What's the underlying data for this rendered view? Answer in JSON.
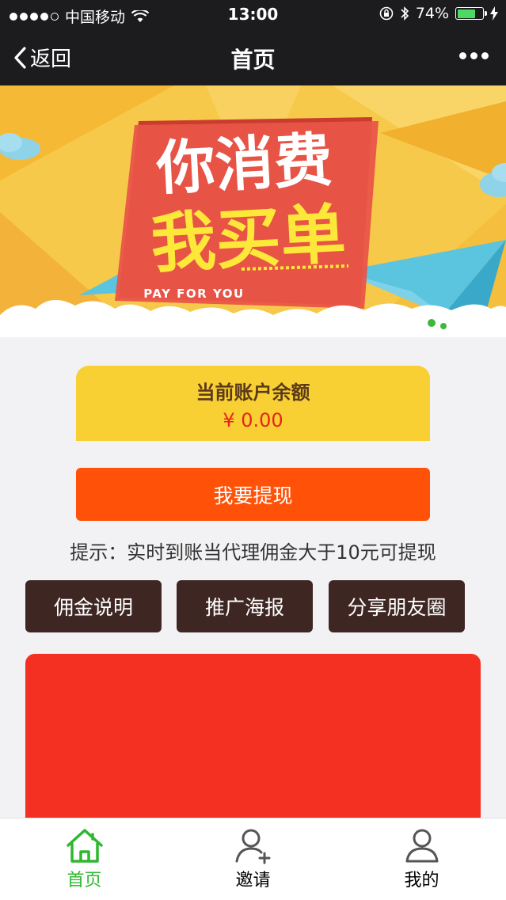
{
  "status_bar": {
    "carrier": "中国移动",
    "time": "13:00",
    "battery_percent": "74%",
    "battery_level": 0.74,
    "icons": [
      "signal-dots",
      "wifi-icon",
      "orientation-lock-icon",
      "bluetooth-icon",
      "battery-icon",
      "charging-icon"
    ]
  },
  "nav": {
    "back_label": "返回",
    "title": "首页",
    "more_icon": "more-dots-icon"
  },
  "banner": {
    "line1": "你消费",
    "line2": "我买单",
    "subtitle": "PAY FOR YOU"
  },
  "balance": {
    "title": "当前账户余额",
    "amount": "¥ 0.00"
  },
  "withdraw_label": "我要提现",
  "tip": "提示：实时到账当代理佣金大于10元可提现",
  "actions": [
    "佣金说明",
    "推广海报",
    "分享朋友圈"
  ],
  "tabs": [
    {
      "label": "首页",
      "icon": "home-icon",
      "active": true
    },
    {
      "label": "邀请",
      "icon": "invite-user-icon",
      "active": false
    },
    {
      "label": "我的",
      "icon": "profile-icon",
      "active": false
    }
  ],
  "colors": {
    "accent_orange": "#ff5208",
    "balance_yellow": "#f8d033",
    "amount_red": "#e8231c",
    "action_brown": "#3e2723",
    "panel_red": "#f33022",
    "tab_active_green": "#2eb82e"
  }
}
